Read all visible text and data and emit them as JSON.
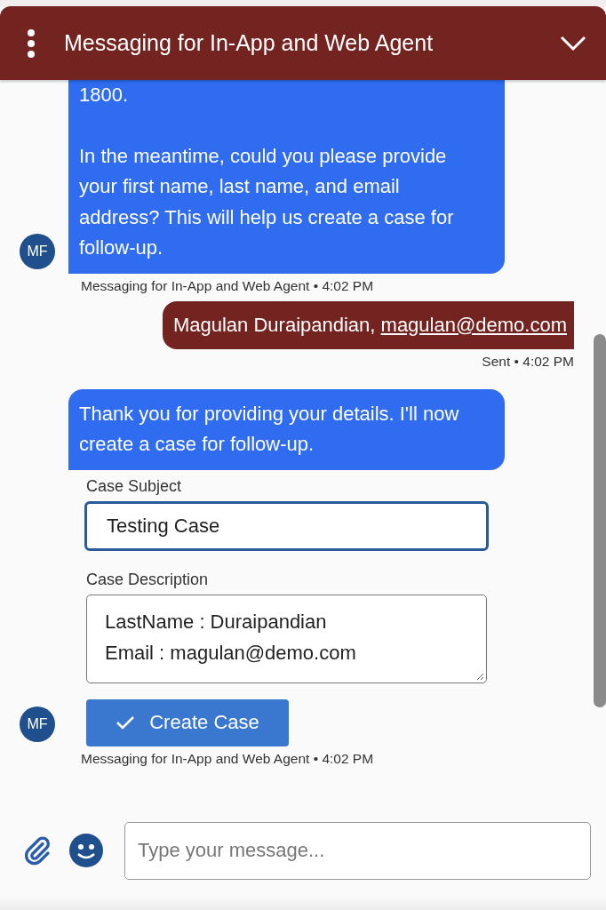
{
  "header": {
    "title": "Messaging for In-App and Web Agent"
  },
  "messages": [
    {
      "kind": "agent_text",
      "avatar": "MF",
      "paragraphs": [
        "1800.",
        "In the meantime, could you please provide your first name, last name, and email address? This will help us create a case for follow-up."
      ],
      "meta": "Messaging for In-App and Web Agent • 4:02 PM"
    },
    {
      "kind": "user_text",
      "text": "Magulan Duraipandian, ",
      "link": "magulan@demo.com",
      "meta": "Sent • 4:02 PM"
    },
    {
      "kind": "agent_form",
      "avatar": "MF",
      "paragraphs": [
        "Thank you for providing your details. I'll now create a case for follow-up."
      ],
      "subject_label": "Case Subject",
      "subject_value": "Testing Case",
      "description_label": "Case Description",
      "description_lines": [
        "LastName : Duraipandian",
        "Email : magulan@demo.com"
      ],
      "button": "Create Case",
      "meta": "Messaging for In-App and Web Agent • 4:02 PM"
    }
  ],
  "composer": {
    "placeholder": "Type your message..."
  }
}
